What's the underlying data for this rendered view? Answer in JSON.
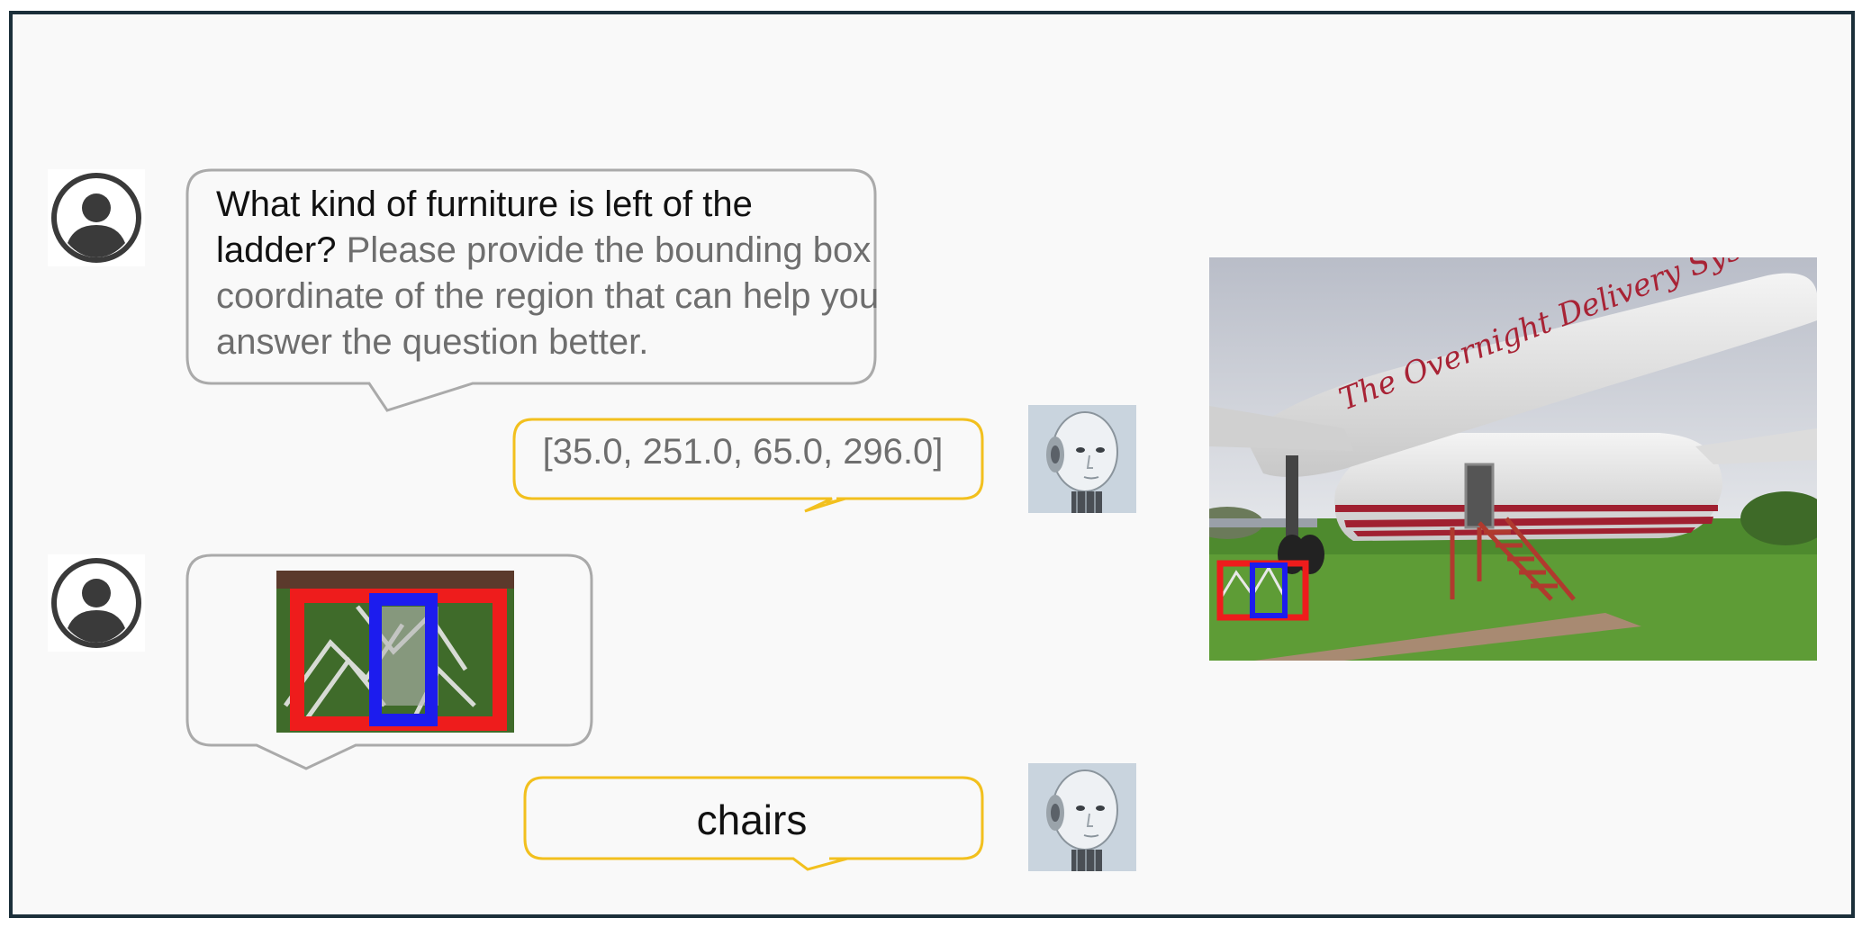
{
  "conversation": {
    "user_question": "What kind of furniture is left of the ladder?",
    "user_instruction": "Please provide the bounding box coordinate of the region that can help you answer the question better.",
    "model_bbox_reply": "[35.0, 251.0, 65.0, 296.0]",
    "model_answer": "chairs"
  },
  "image": {
    "plane_lettering": "The Overnight Delivery System"
  },
  "colors": {
    "frame_border": "#1b2f3a",
    "user_bubble_border": "#aaaaaa",
    "model_bubble_border": "#f2c01e",
    "bbox_red": "#ee1c1c",
    "bbox_blue": "#1c1cee",
    "instruction_text": "#6e6e6e"
  },
  "icons": {
    "user_avatar": "user-avatar-icon",
    "model_avatar": "robot-avatar-icon"
  }
}
